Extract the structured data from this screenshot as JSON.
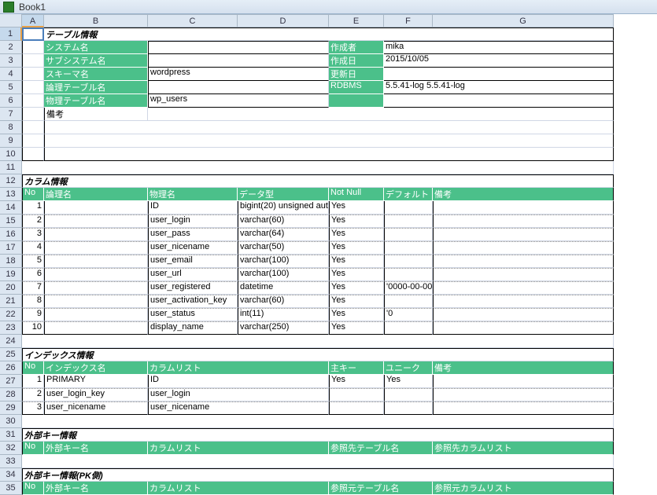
{
  "workbook_name": "Book1",
  "columns": [
    "A",
    "B",
    "C",
    "D",
    "E",
    "F",
    "G"
  ],
  "rows": [
    "1",
    "2",
    "3",
    "4",
    "5",
    "6",
    "7",
    "8",
    "9",
    "10",
    "11",
    "12",
    "13",
    "14",
    "15",
    "16",
    "17",
    "18",
    "19",
    "20",
    "21",
    "22",
    "23",
    "24",
    "25",
    "26",
    "27",
    "28",
    "29",
    "30",
    "31",
    "32",
    "33",
    "34",
    "35"
  ],
  "section1": {
    "title": "テーブル情報",
    "labels": {
      "system": "システム名",
      "subsystem": "サブシステム名",
      "schema": "スキーマ名",
      "logical_table": "論理テーブル名",
      "physical_table": "物理テーブル名",
      "creator": "作成者",
      "create_date": "作成日",
      "update_date": "更新日",
      "rdbms": "RDBMS",
      "remarks": "備考"
    },
    "values": {
      "schema": "wordpress",
      "physical_table": "wp_users",
      "creator": "mika",
      "create_date": "2015/10/05",
      "rdbms": "5.5.41-log 5.5.41-log"
    }
  },
  "section2": {
    "title": "カラム情報",
    "headers": {
      "no": "No",
      "logical": "論理名",
      "physical": "物理名",
      "type": "データ型",
      "notnull": "Not Null",
      "default": "デフォルト",
      "remarks": "備考"
    },
    "rows": [
      {
        "no": "1",
        "physical": "ID",
        "type": "bigint(20) unsigned aut",
        "notnull": "Yes",
        "default": ""
      },
      {
        "no": "2",
        "physical": "user_login",
        "type": "varchar(60)",
        "notnull": "Yes",
        "default": ""
      },
      {
        "no": "3",
        "physical": "user_pass",
        "type": "varchar(64)",
        "notnull": "Yes",
        "default": ""
      },
      {
        "no": "4",
        "physical": "user_nicename",
        "type": "varchar(50)",
        "notnull": "Yes",
        "default": ""
      },
      {
        "no": "5",
        "physical": "user_email",
        "type": "varchar(100)",
        "notnull": "Yes",
        "default": ""
      },
      {
        "no": "6",
        "physical": "user_url",
        "type": "varchar(100)",
        "notnull": "Yes",
        "default": ""
      },
      {
        "no": "7",
        "physical": "user_registered",
        "type": "datetime",
        "notnull": "Yes",
        "default": "'0000-00-00"
      },
      {
        "no": "8",
        "physical": "user_activation_key",
        "type": "varchar(60)",
        "notnull": "Yes",
        "default": ""
      },
      {
        "no": "9",
        "physical": "user_status",
        "type": "int(11)",
        "notnull": "Yes",
        "default": "'0"
      },
      {
        "no": "10",
        "physical": "display_name",
        "type": "varchar(250)",
        "notnull": "Yes",
        "default": ""
      }
    ]
  },
  "section3": {
    "title": "インデックス情報",
    "headers": {
      "no": "No",
      "name": "インデックス名",
      "cols": "カラムリスト",
      "pk": "主キー",
      "uq": "ユニーク",
      "remarks": "備考"
    },
    "rows": [
      {
        "no": "1",
        "name": "PRIMARY",
        "cols": "ID",
        "pk": "Yes",
        "uq": "Yes"
      },
      {
        "no": "2",
        "name": "user_login_key",
        "cols": "user_login",
        "pk": "",
        "uq": ""
      },
      {
        "no": "3",
        "name": "user_nicename",
        "cols": "user_nicename",
        "pk": "",
        "uq": ""
      }
    ]
  },
  "section4": {
    "title": "外部キー情報",
    "headers": {
      "no": "No",
      "name": "外部キー名",
      "cols": "カラムリスト",
      "reftable": "参照先テーブル名",
      "refcols": "参照先カラムリスト"
    }
  },
  "section5": {
    "title": "外部キー情報(PK側)",
    "headers": {
      "no": "No",
      "name": "外部キー名",
      "cols": "カラムリスト",
      "reftable": "参照元テーブル名",
      "refcols": "参照元カラムリスト"
    }
  }
}
